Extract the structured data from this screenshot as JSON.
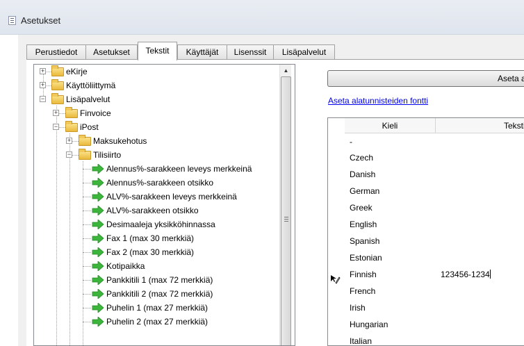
{
  "window": {
    "title": "Asetukset"
  },
  "tabs": [
    {
      "label": "Perustiedot",
      "active": false
    },
    {
      "label": "Asetukset",
      "active": false
    },
    {
      "label": "Tekstit",
      "active": true
    },
    {
      "label": "Käyttäjät",
      "active": false
    },
    {
      "label": "Lisenssit",
      "active": false
    },
    {
      "label": "Lisäpalvelut",
      "active": false
    }
  ],
  "tree": {
    "nodes": [
      {
        "label": "eKirje",
        "kind": "folder",
        "expander": "+"
      },
      {
        "label": "Käyttöliittymä",
        "kind": "folder",
        "expander": "+"
      },
      {
        "label": "Lisäpalvelut",
        "kind": "folder",
        "expander": "−"
      },
      {
        "label": "Finvoice",
        "kind": "folder",
        "expander": "+"
      },
      {
        "label": "iPost",
        "kind": "folder",
        "expander": "−"
      },
      {
        "label": "Maksukehotus",
        "kind": "folder",
        "expander": "+"
      },
      {
        "label": "Tilisiirto",
        "kind": "folder",
        "expander": "−"
      },
      {
        "label": "Alennus%-sarakkeen leveys merkkeinä",
        "kind": "item"
      },
      {
        "label": "Alennus%-sarakkeen otsikko",
        "kind": "item"
      },
      {
        "label": "ALV%-sarakkeen leveys merkkeinä",
        "kind": "item"
      },
      {
        "label": "ALV%-sarakkeen otsikko",
        "kind": "item"
      },
      {
        "label": "Desimaaleja yksikköhinnassa",
        "kind": "item"
      },
      {
        "label": "Fax 1 (max 30 merkkiä)",
        "kind": "item"
      },
      {
        "label": "Fax 2 (max 30 merkkiä)",
        "kind": "item"
      },
      {
        "label": "Kotipaikka",
        "kind": "item"
      },
      {
        "label": "Pankkitili 1 (max 72 merkkiä)",
        "kind": "item"
      },
      {
        "label": "Pankkitili 2 (max 72 merkkiä)",
        "kind": "item"
      },
      {
        "label": "Puhelin 1 (max 27 merkkiä)",
        "kind": "item"
      },
      {
        "label": "Puhelin 2 (max 27 merkkiä)",
        "kind": "item"
      }
    ]
  },
  "footer_button": {
    "label": "Aseta alatunnisteet"
  },
  "font_link": {
    "label": "Aseta alatunnisteiden fontti"
  },
  "grid": {
    "columns": [
      "Kieli",
      "Teksti"
    ],
    "rows": [
      {
        "language": "-",
        "text": ""
      },
      {
        "language": "Czech",
        "text": ""
      },
      {
        "language": "Danish",
        "text": ""
      },
      {
        "language": "German",
        "text": ""
      },
      {
        "language": "Greek",
        "text": ""
      },
      {
        "language": "English",
        "text": ""
      },
      {
        "language": "Spanish",
        "text": ""
      },
      {
        "language": "Estonian",
        "text": ""
      },
      {
        "language": "Finnish",
        "text": "123456-1234",
        "editing": true
      },
      {
        "language": "French",
        "text": ""
      },
      {
        "language": "Irish",
        "text": ""
      },
      {
        "language": "Hungarian",
        "text": ""
      },
      {
        "language": "Italian",
        "text": ""
      }
    ]
  },
  "colors": {
    "accent_link": "#0000ee",
    "arrow_green": "#3cb53c",
    "folder_yellow": "#f0c95a"
  },
  "icons": {
    "expand": "plus-box-icon",
    "collapse": "minus-box-icon",
    "folder": "folder-icon",
    "item": "green-arrow-icon",
    "editing_row": "pencil-icon"
  }
}
